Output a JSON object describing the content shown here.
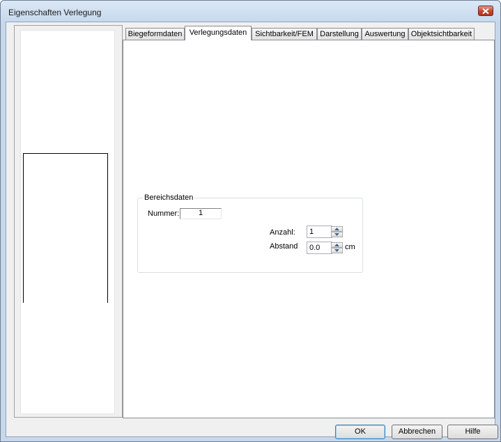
{
  "window": {
    "title": "Eigenschaften Verlegung"
  },
  "tabs": [
    {
      "label": "Biegeformdaten"
    },
    {
      "label": "Verlegungsdaten"
    },
    {
      "label": "Sichtbarkeit/FEM"
    },
    {
      "label": "Darstellung"
    },
    {
      "label": "Auswertung"
    },
    {
      "label": "Objektsichtbarkeit"
    }
  ],
  "group": {
    "title": "Bereichsdaten",
    "nummer_label": "Nummer:",
    "nummer_value": "1",
    "anzahl_label": "Anzahl:",
    "anzahl_value": "1",
    "abstand_label": "Abstand",
    "abstand_value": "0.0",
    "abstand_unit": "cm"
  },
  "buttons": {
    "ok": "OK",
    "cancel": "Abbrechen",
    "help": "Hilfe"
  },
  "colors": {
    "close_button": "#c0452e",
    "window_frame": "#c8d8ea"
  },
  "icons": {
    "close": "close-icon",
    "spin_up": "arrow-up-icon",
    "spin_down": "arrow-down-icon"
  }
}
